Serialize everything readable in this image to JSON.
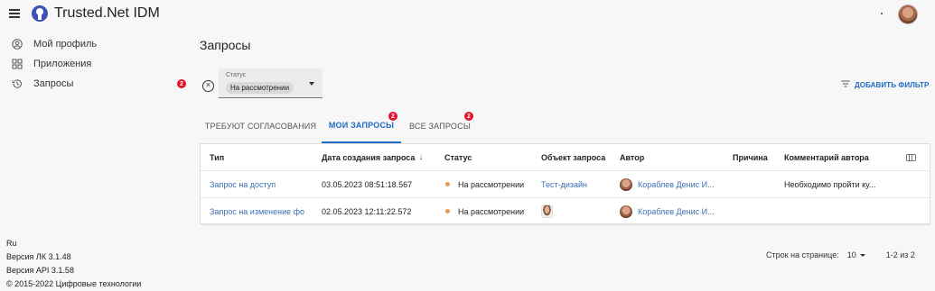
{
  "app": {
    "title": "Trusted.Net IDM"
  },
  "sidebar": {
    "items": [
      {
        "label": "Мой профиль",
        "icon": "account-circle-icon"
      },
      {
        "label": "Приложения",
        "icon": "apps-grid-icon"
      },
      {
        "label": "Запросы",
        "icon": "history-icon",
        "badge": "2"
      }
    ]
  },
  "footer": {
    "lang": "Ru",
    "version_lk": "Версия ЛК 3.1.48",
    "version_api": "Версия API 3.1.58",
    "copyright": "© 2015-2022 Цифровые технологии"
  },
  "page": {
    "title": "Запросы"
  },
  "filter": {
    "label": "Статус",
    "value": "На рассмотрении",
    "add_filter": "ДОБАВИТЬ ФИЛЬТР"
  },
  "tabs": [
    {
      "label": "ТРЕБУЮТ СОГЛАСОВАНИЯ"
    },
    {
      "label": "МОИ ЗАПРОСЫ",
      "badge": "2",
      "active": true
    },
    {
      "label": "ВСЕ ЗАПРОСЫ",
      "badge": "2"
    }
  ],
  "table": {
    "headers": [
      "Тип",
      "Дата создания запроса",
      "Статус",
      "Объект запроса",
      "Автор",
      "Причина",
      "Комментарий автора"
    ],
    "rows": [
      {
        "type": "Запрос на доступ",
        "date": "03.05.2023 08:51:18.567",
        "status": "На рассмотрении",
        "object": "Тест-дизайн",
        "author": "Кораблев Денис И...",
        "reason": "",
        "comment": "Необходимо пройти ку..."
      },
      {
        "type": "Запрос на изменение фот",
        "date": "02.05.2023 12:11:22.572",
        "status": "На рассмотрении",
        "object": "",
        "author": "Кораблев Денис И...",
        "reason": "",
        "comment": ""
      }
    ]
  },
  "pagination": {
    "rows_label": "Строк на странице:",
    "rows_value": "10",
    "range": "1-2 из 2"
  },
  "colors": {
    "accent": "#1e6bc1",
    "badge": "#e0142a",
    "status_pending": "#f2994a"
  }
}
